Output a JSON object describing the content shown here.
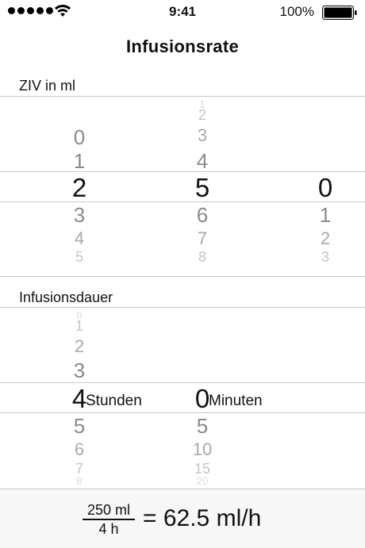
{
  "status_bar": {
    "time": "9:41",
    "battery": "100%",
    "signal_dots": 5
  },
  "title": "Infusionsrate",
  "ziv_section": {
    "label": "ZIV in ml",
    "col_hundreds": {
      "above": [
        "0",
        "1"
      ],
      "selected": "2",
      "below": [
        "3",
        "4",
        "5"
      ]
    },
    "col_tens": {
      "above": [
        "1",
        "2",
        "3",
        "4"
      ],
      "selected": "5",
      "below": [
        "6",
        "7",
        "8"
      ]
    },
    "col_ones": {
      "above": [],
      "selected": "0",
      "below": [
        "1",
        "2",
        "3"
      ]
    }
  },
  "duration_section": {
    "label": "Infusionsdauer",
    "hours": {
      "above": [
        "0",
        "1",
        "2",
        "3"
      ],
      "selected": "4",
      "below": [
        "5",
        "6",
        "7",
        "8"
      ],
      "unit": "Stunden"
    },
    "minutes": {
      "above": [],
      "selected": "0",
      "below": [
        "5",
        "10",
        "15",
        "20"
      ],
      "unit": "Minuten"
    }
  },
  "result": {
    "numerator": "250 ml",
    "denominator": "4 h",
    "value": "= 62.5 ml/h"
  }
}
